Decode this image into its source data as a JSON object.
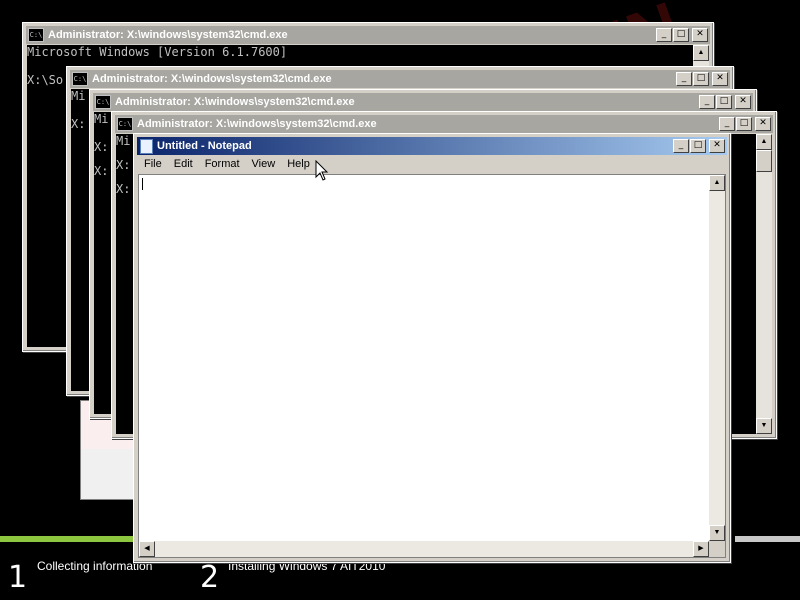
{
  "watermark": "APPIN",
  "setup": {
    "step1_number": "1",
    "step1_label": "Collecting information",
    "step2_number": "2",
    "step2_label": "Installing Windows 7 AIT2010",
    "colors": {
      "progress": "#8dc63f"
    }
  },
  "cmd_window_1": {
    "title": "Administrator: X:\\windows\\system32\\cmd.exe",
    "lines": [
      "Microsoft Windows [Version 6.1.7600]",
      "",
      "X:\\So"
    ],
    "icon": "console-icon"
  },
  "cmd_window_2": {
    "title": "Administrator: X:\\windows\\system32\\cmd.exe",
    "lines": [
      "Mi",
      "",
      "X:"
    ],
    "icon": "console-icon"
  },
  "cmd_window_3": {
    "title": "Administrator: X:\\windows\\system32\\cmd.exe",
    "lines": [
      "Mi",
      "",
      "X:",
      "",
      "X:"
    ],
    "icon": "console-icon"
  },
  "cmd_window_4": {
    "title": "Administrator: X:\\windows\\system32\\cmd.exe",
    "lines": [
      "Mi",
      "",
      "",
      "X:",
      "",
      "X:"
    ],
    "icon": "console-icon"
  },
  "notepad": {
    "title": "Untitled - Notepad",
    "menu": [
      "File",
      "Edit",
      "Format",
      "View",
      "Help"
    ],
    "content": "",
    "icon": "notepad-icon"
  },
  "window_buttons": {
    "minimize": "_",
    "maximize": "□",
    "close": "✕"
  }
}
